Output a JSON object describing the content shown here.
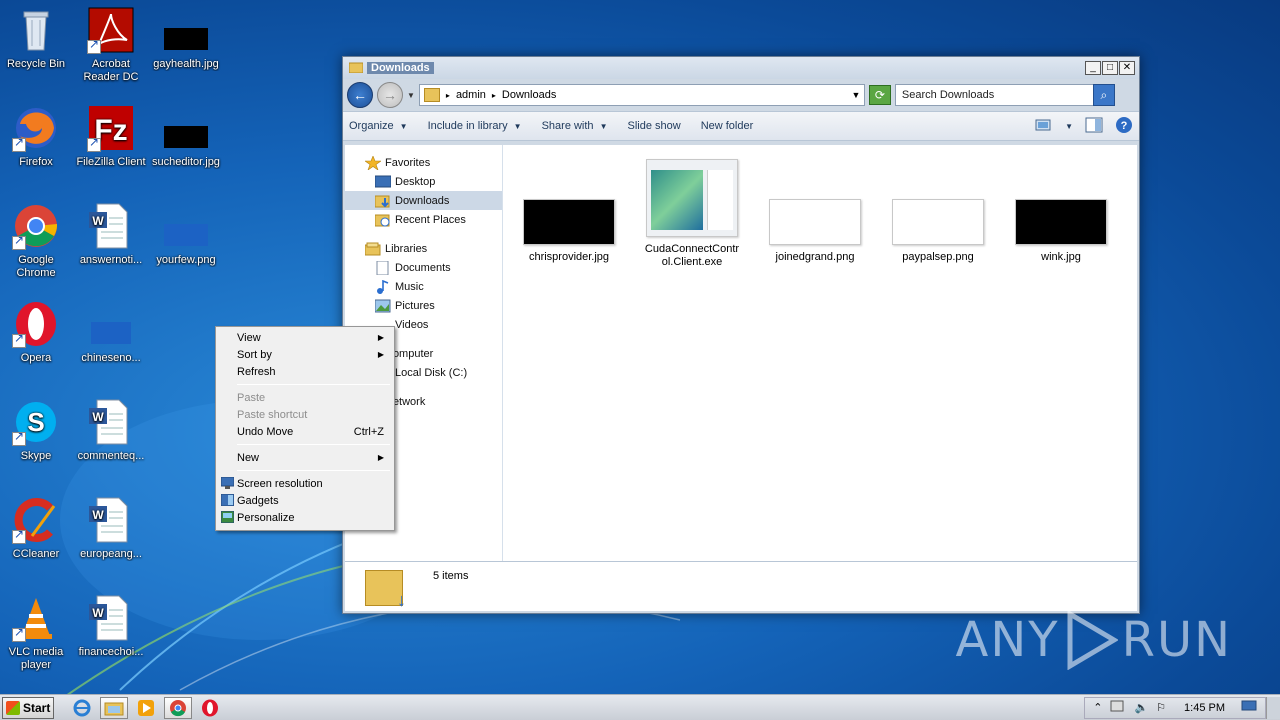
{
  "desktop": {
    "icons": [
      {
        "label": "Recycle Bin"
      },
      {
        "label": "Acrobat Reader DC"
      },
      {
        "label": "gayhealth.jpg"
      },
      {
        "label": "Firefox"
      },
      {
        "label": "FileZilla Client"
      },
      {
        "label": "sucheditor.jpg"
      },
      {
        "label": "Google Chrome"
      },
      {
        "label": "answernoti..."
      },
      {
        "label": "yourfew.png"
      },
      {
        "label": "Opera"
      },
      {
        "label": "chineseno..."
      },
      {
        "label": "Skype"
      },
      {
        "label": "commenteq..."
      },
      {
        "label": "CCleaner"
      },
      {
        "label": "europeang..."
      },
      {
        "label": "VLC media player"
      },
      {
        "label": "financechoi..."
      }
    ]
  },
  "explorer": {
    "title": "Downloads",
    "breadcrumb": [
      "admin",
      "Downloads"
    ],
    "search_placeholder": "Search Downloads",
    "toolbar": {
      "organize": "Organize",
      "include_in_library": "Include in library",
      "share_with": "Share with",
      "slide_show": "Slide show",
      "new_folder": "New folder"
    },
    "nav": {
      "favorites": "Favorites",
      "desktop": "Desktop",
      "downloads": "Downloads",
      "recent_places": "Recent Places",
      "libraries": "Libraries",
      "documents": "Documents",
      "music": "Music",
      "pictures": "Pictures",
      "videos": "Videos",
      "computer": "Computer",
      "local_disk": "Local Disk (C:)",
      "network": "Network"
    },
    "files": [
      {
        "name": "chrisprovider.jpg"
      },
      {
        "name": "CudaConnectControl.Client.exe"
      },
      {
        "name": "joinedgrand.png"
      },
      {
        "name": "paypalsep.png"
      },
      {
        "name": "wink.jpg"
      }
    ],
    "status": "5 items"
  },
  "context_menu": {
    "view": "View",
    "sort_by": "Sort by",
    "refresh": "Refresh",
    "paste": "Paste",
    "paste_shortcut": "Paste shortcut",
    "undo_move": "Undo Move",
    "undo_shortcut": "Ctrl+Z",
    "new": "New",
    "screen_resolution": "Screen resolution",
    "gadgets": "Gadgets",
    "personalize": "Personalize"
  },
  "taskbar": {
    "start": "Start",
    "time": "1:45 PM"
  },
  "watermark": {
    "left": "ANY",
    "right": "RUN"
  }
}
